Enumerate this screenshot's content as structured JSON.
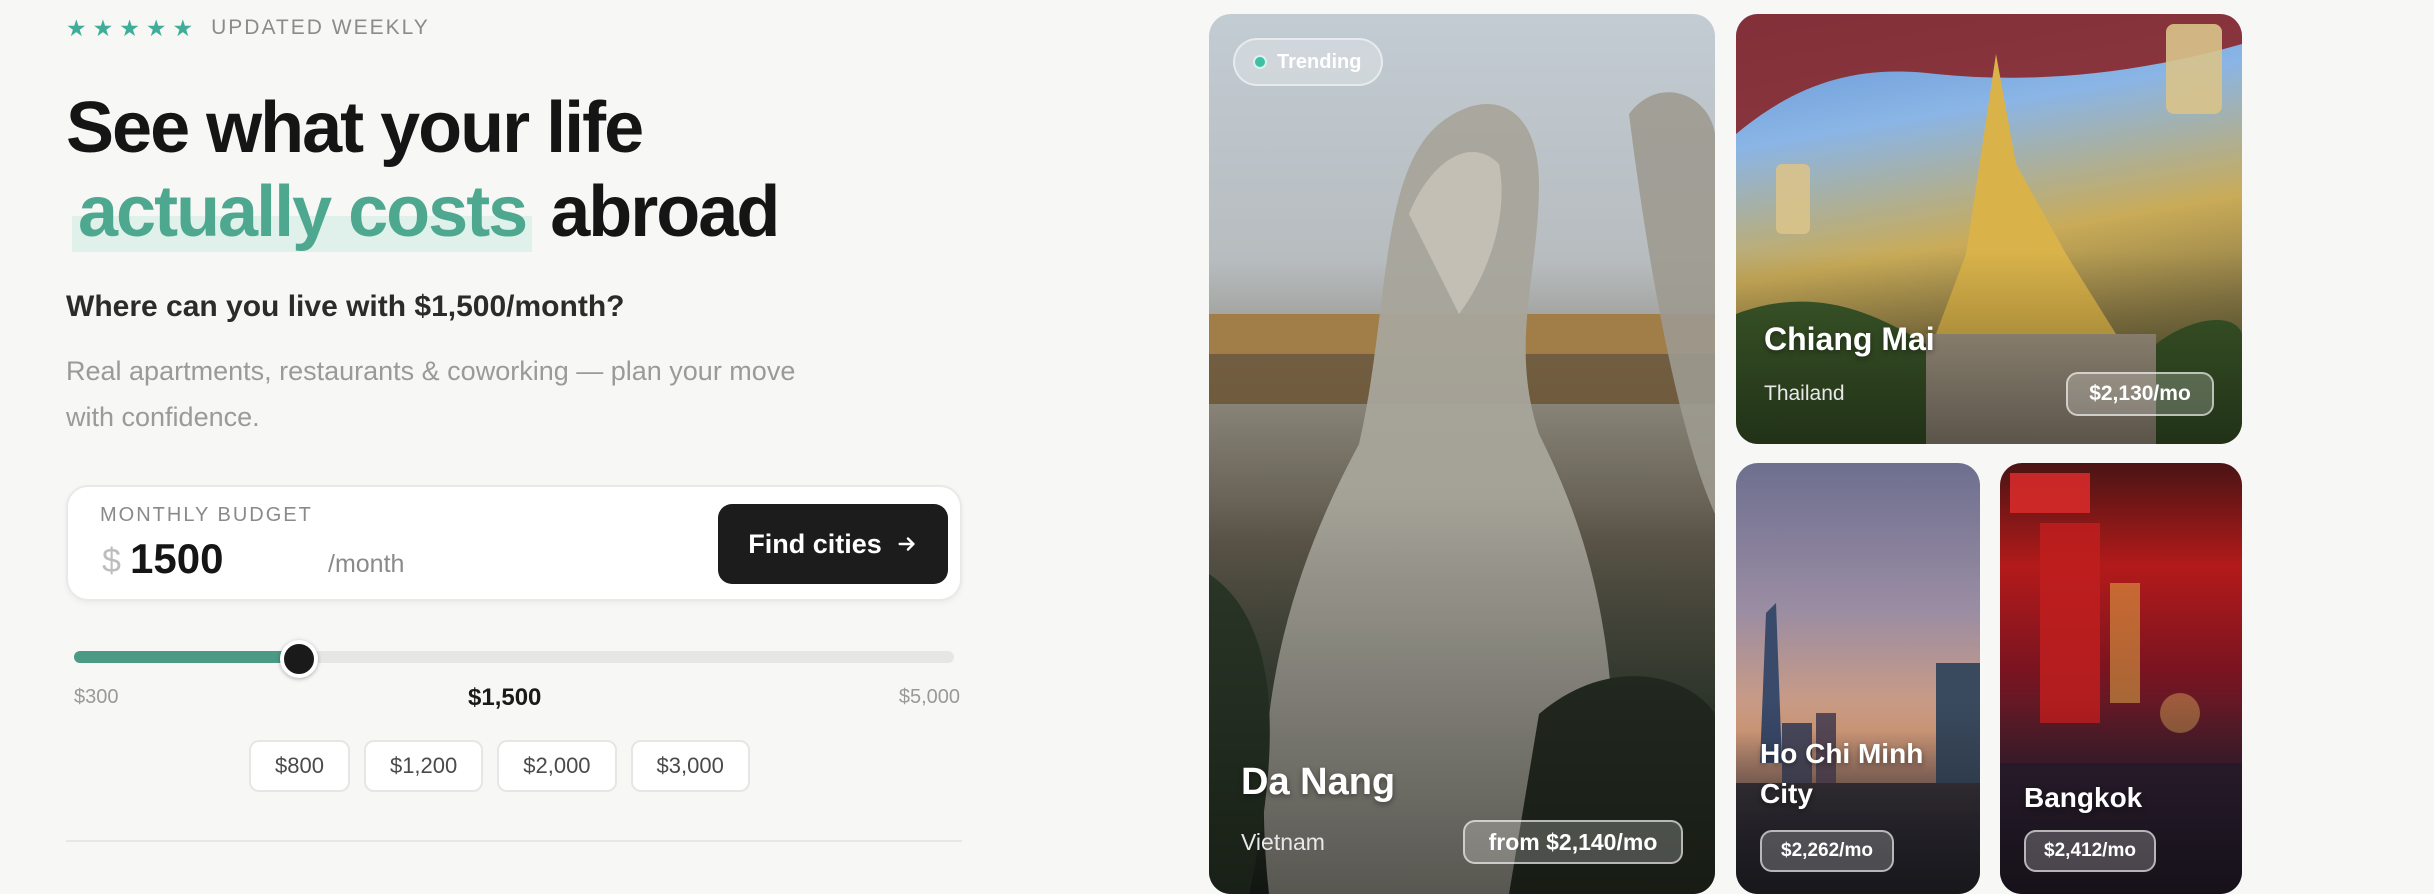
{
  "rating": {
    "stars": [
      "★",
      "★",
      "★",
      "★",
      "★"
    ],
    "label": "UPDATED WEEKLY",
    "star_color": "#3fae98"
  },
  "headline": {
    "line1": "See what your life",
    "accent": "actually costs",
    "tail": "abroad",
    "accent_color": "#4ea88f"
  },
  "subhead": "Where can you live with $1,500/month?",
  "description": "Real apartments, restaurants & coworking — plan your move with confidence.",
  "budget": {
    "label": "MONTHLY BUDGET",
    "currency": "$",
    "value": "1500",
    "unit": "/month",
    "button_label": "Find cities",
    "button_icon": "arrow-right-icon"
  },
  "slider": {
    "min_label": "$300",
    "current_label": "$1,500",
    "max_label": "$5,000",
    "min": 300,
    "max": 5000,
    "value": 1500
  },
  "presets": [
    "$800",
    "$1,200",
    "$2,000",
    "$3,000"
  ],
  "cities": [
    {
      "name": "Da Nang",
      "country": "Vietnam",
      "price": "from $2,140/mo",
      "badge": "Trending"
    },
    {
      "name": "Chiang Mai",
      "country": "Thailand",
      "price": "$2,130/mo"
    },
    {
      "name": "Ho Chi Minh City",
      "price": "$2,262/mo"
    },
    {
      "name": "Bangkok",
      "price": "$2,412/mo"
    }
  ]
}
